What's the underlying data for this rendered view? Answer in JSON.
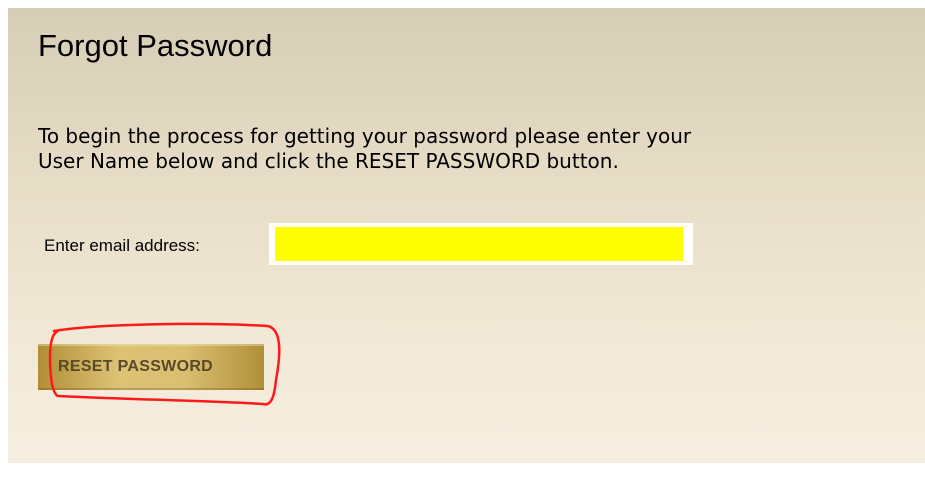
{
  "page": {
    "title": "Forgot Password",
    "intro_line1": "To begin the process for getting your password please enter your",
    "intro_line2": "User Name below and click the RESET PASSWORD button."
  },
  "form": {
    "email_label": "Enter email address:",
    "email_value": "",
    "reset_button_label": "RESET PASSWORD"
  },
  "colors": {
    "panel_top": "#d6cdb6",
    "panel_bottom": "#f6eee0",
    "input_highlight": "#ffff00",
    "button_gold": "#d4b96a",
    "button_text": "#5a4a26",
    "annotation_red": "#ff1a1a"
  }
}
